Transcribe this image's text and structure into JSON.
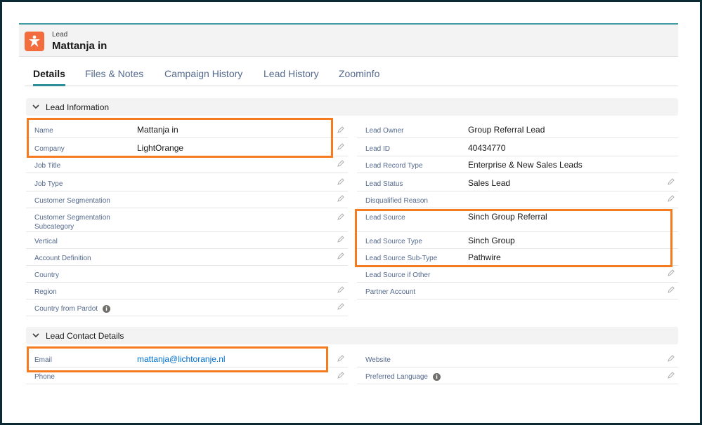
{
  "header": {
    "object_type": "Lead",
    "record_name": "Mattanja in"
  },
  "tabs": [
    "Details",
    "Files & Notes",
    "Campaign History",
    "Lead History",
    "Zoominfo"
  ],
  "sections": {
    "lead_information": {
      "title": "Lead Information"
    },
    "lead_contact": {
      "title": "Lead Contact Details"
    }
  },
  "left_fields": [
    {
      "label": "Name",
      "value": "Mattanja in"
    },
    {
      "label": "Company",
      "value": "LightOrange"
    },
    {
      "label": "Job Title",
      "value": ""
    },
    {
      "label": "Job Type",
      "value": ""
    },
    {
      "label": "Customer Segmentation",
      "value": ""
    },
    {
      "label": "Customer Segmentation Subcategory",
      "value": ""
    },
    {
      "label": "Vertical",
      "value": ""
    },
    {
      "label": "Account Definition",
      "value": ""
    },
    {
      "label": "Country",
      "value": ""
    },
    {
      "label": "Region",
      "value": ""
    },
    {
      "label": "Country from Pardot",
      "value": ""
    }
  ],
  "right_fields": [
    {
      "label": "Lead Owner",
      "value": "Group Referral Lead"
    },
    {
      "label": "Lead ID",
      "value": "40434770"
    },
    {
      "label": "Lead Record Type",
      "value": "Enterprise & New Sales Leads"
    },
    {
      "label": "Lead Status",
      "value": "Sales Lead"
    },
    {
      "label": "Disqualified Reason",
      "value": ""
    },
    {
      "label": "Lead Source",
      "value": "Sinch Group Referral"
    },
    {
      "label": "Lead Source Type",
      "value": "Sinch Group"
    },
    {
      "label": "Lead Source Sub-Type",
      "value": "Pathwire"
    },
    {
      "label": "Lead Source if Other",
      "value": ""
    },
    {
      "label": "Partner Account",
      "value": ""
    }
  ],
  "contact_left": [
    {
      "label": "Email",
      "value": "mattanja@lichtoranje.nl"
    },
    {
      "label": "Phone",
      "value": ""
    }
  ],
  "contact_right": [
    {
      "label": "Website",
      "value": ""
    },
    {
      "label": "Preferred Language",
      "value": ""
    }
  ],
  "colors": {
    "highlight": "#f47b20",
    "lead_icon": "#f26c3d",
    "accent": "#2e8f9a",
    "link": "#0070d2"
  }
}
